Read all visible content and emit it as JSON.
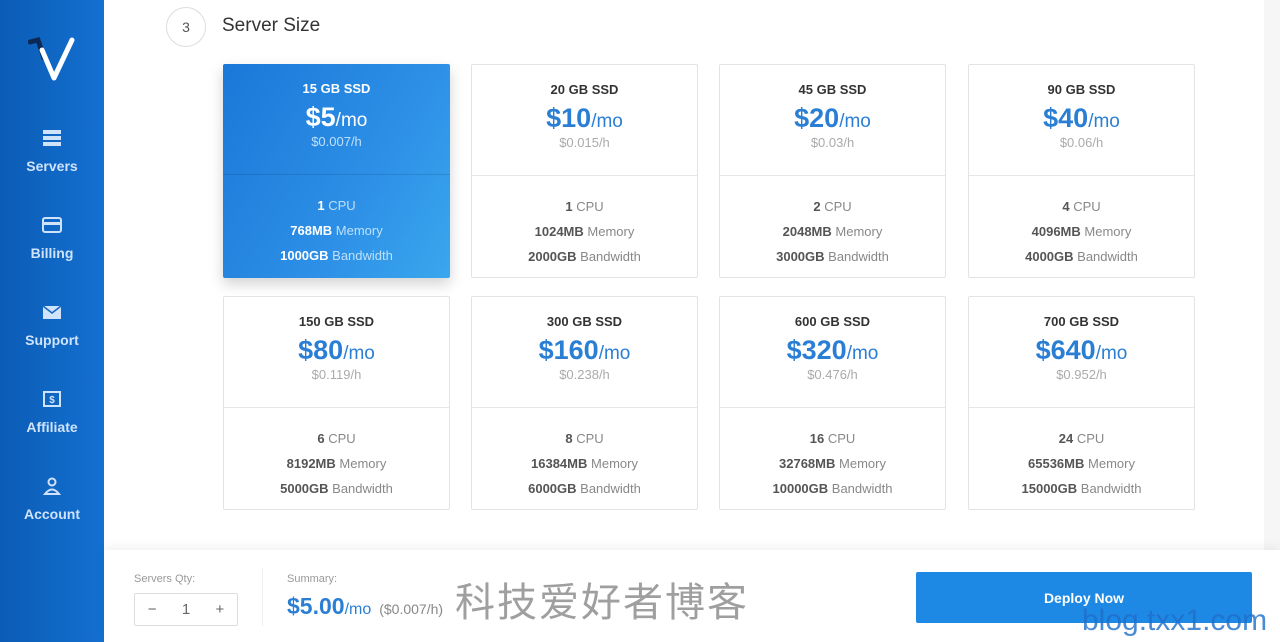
{
  "sidebar": {
    "items": [
      {
        "label": "Servers",
        "icon": "servers-icon"
      },
      {
        "label": "Billing",
        "icon": "credit-card-icon"
      },
      {
        "label": "Support",
        "icon": "envelope-icon"
      },
      {
        "label": "Affiliate",
        "icon": "dollar-icon"
      },
      {
        "label": "Account",
        "icon": "user-icon"
      }
    ]
  },
  "section": {
    "step": "3",
    "title": "Server Size"
  },
  "plans": [
    {
      "ssd": "15 GB SSD",
      "price": "$5",
      "per": "/mo",
      "hourly": "$0.007/h",
      "cpu": "1",
      "cpu_label": "CPU",
      "mem": "768MB",
      "mem_label": "Memory",
      "bw": "1000GB",
      "bw_label": "Bandwidth",
      "selected": true
    },
    {
      "ssd": "20 GB SSD",
      "price": "$10",
      "per": "/mo",
      "hourly": "$0.015/h",
      "cpu": "1",
      "cpu_label": "CPU",
      "mem": "1024MB",
      "mem_label": "Memory",
      "bw": "2000GB",
      "bw_label": "Bandwidth"
    },
    {
      "ssd": "45 GB SSD",
      "price": "$20",
      "per": "/mo",
      "hourly": "$0.03/h",
      "cpu": "2",
      "cpu_label": "CPU",
      "mem": "2048MB",
      "mem_label": "Memory",
      "bw": "3000GB",
      "bw_label": "Bandwidth"
    },
    {
      "ssd": "90 GB SSD",
      "price": "$40",
      "per": "/mo",
      "hourly": "$0.06/h",
      "cpu": "4",
      "cpu_label": "CPU",
      "mem": "4096MB",
      "mem_label": "Memory",
      "bw": "4000GB",
      "bw_label": "Bandwidth"
    },
    {
      "ssd": "150 GB SSD",
      "price": "$80",
      "per": "/mo",
      "hourly": "$0.119/h",
      "cpu": "6",
      "cpu_label": "CPU",
      "mem": "8192MB",
      "mem_label": "Memory",
      "bw": "5000GB",
      "bw_label": "Bandwidth"
    },
    {
      "ssd": "300 GB SSD",
      "price": "$160",
      "per": "/mo",
      "hourly": "$0.238/h",
      "cpu": "8",
      "cpu_label": "CPU",
      "mem": "16384MB",
      "mem_label": "Memory",
      "bw": "6000GB",
      "bw_label": "Bandwidth"
    },
    {
      "ssd": "600 GB SSD",
      "price": "$320",
      "per": "/mo",
      "hourly": "$0.476/h",
      "cpu": "16",
      "cpu_label": "CPU",
      "mem": "32768MB",
      "mem_label": "Memory",
      "bw": "10000GB",
      "bw_label": "Bandwidth"
    },
    {
      "ssd": "700 GB SSD",
      "price": "$640",
      "per": "/mo",
      "hourly": "$0.952/h",
      "cpu": "24",
      "cpu_label": "CPU",
      "mem": "65536MB",
      "mem_label": "Memory",
      "bw": "15000GB",
      "bw_label": "Bandwidth"
    }
  ],
  "footer": {
    "qty_label": "Servers Qty:",
    "minus": "−",
    "qty": "1",
    "plus": "+",
    "summary_label": "Summary:",
    "total": "$5.00",
    "per": "/mo",
    "hourly": "($0.007/h)",
    "deploy": "Deploy Now"
  },
  "watermark": {
    "cn": "科技爱好者博客",
    "url": "blog.txx1.com"
  },
  "colors": {
    "accent": "#1e88e5",
    "sidebar": "#0b5cb5"
  }
}
